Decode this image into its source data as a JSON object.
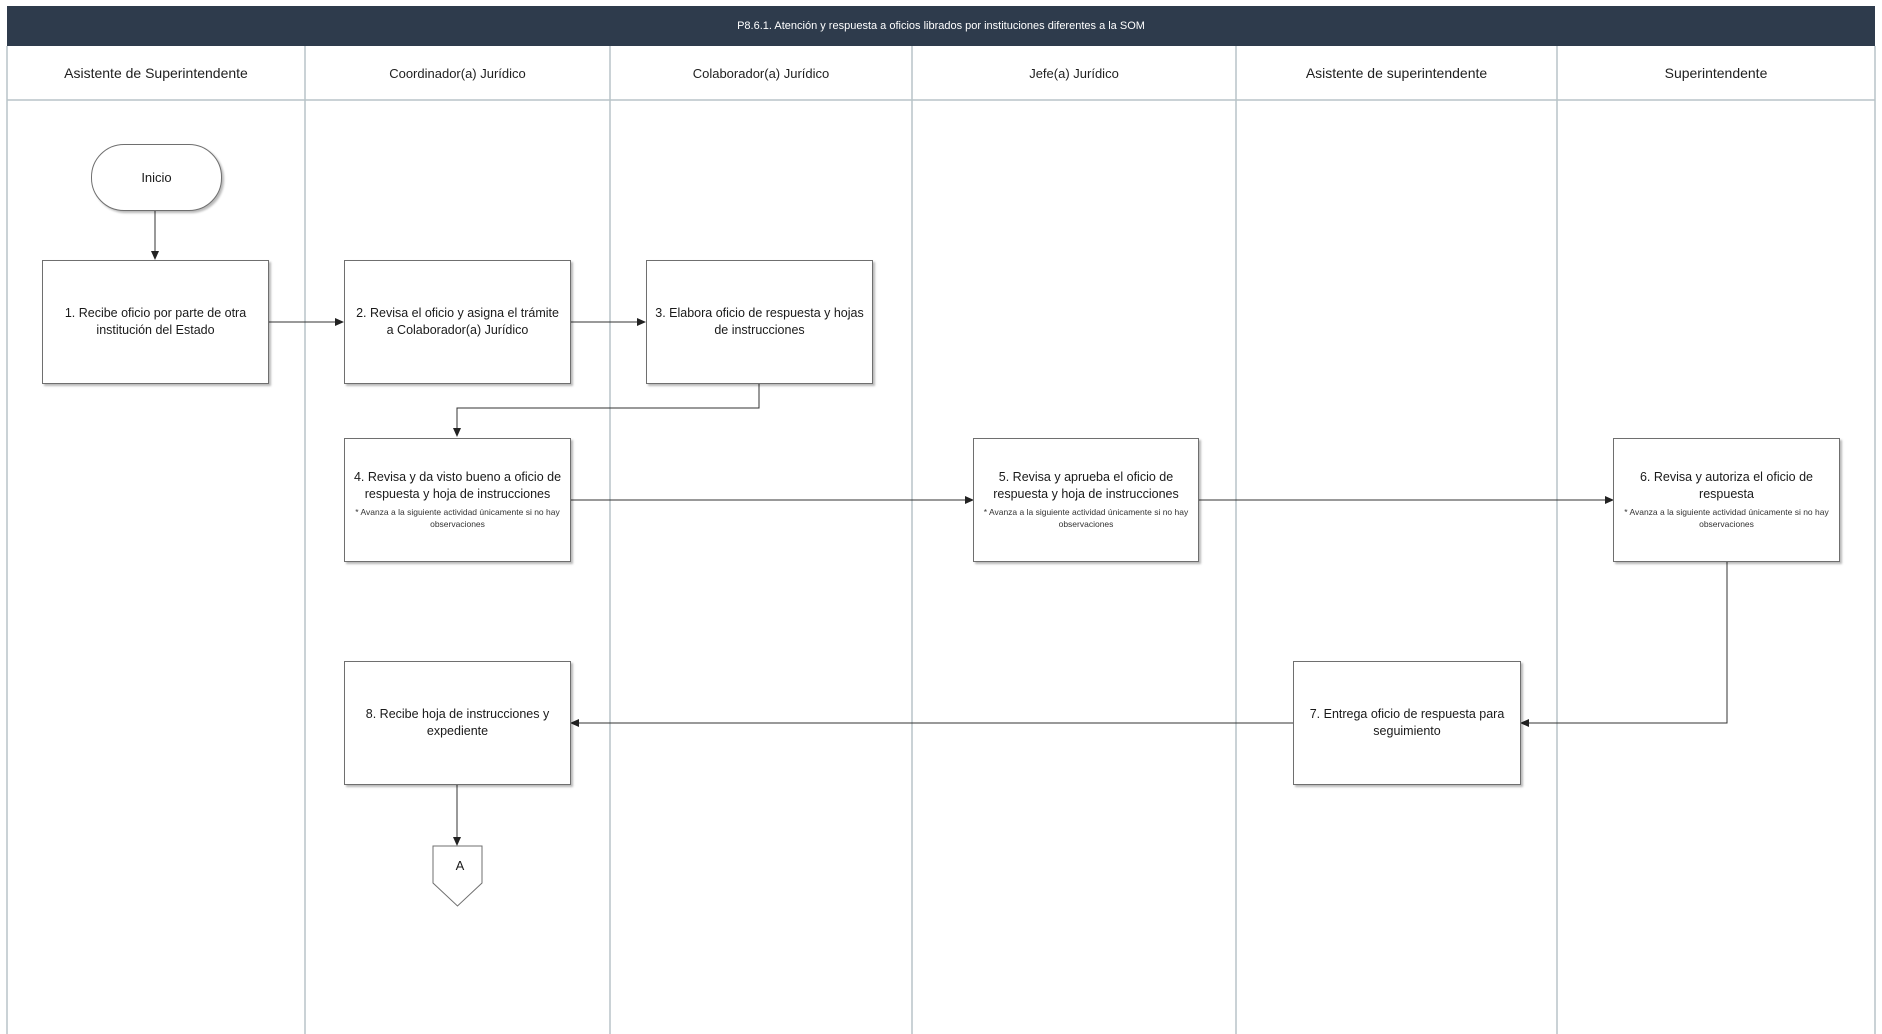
{
  "title": "P8.6.1.  Atención y respuesta a oficios librados por instituciones diferentes a la SOM",
  "lanes": [
    {
      "label": "Asistente de Superintendente"
    },
    {
      "label": "Coordinador(a) Jurídico"
    },
    {
      "label": "Colaborador(a) Jurídico"
    },
    {
      "label": "Jefe(a) Jurídico"
    },
    {
      "label": "Asistente de superintendente"
    },
    {
      "label": "Superintendente"
    }
  ],
  "start": {
    "label": "Inicio"
  },
  "steps": [
    {
      "id": "1",
      "text": "1. Recibe oficio por parte de otra institución del Estado",
      "note": ""
    },
    {
      "id": "2",
      "text": "2. Revisa el oficio y asigna el trámite a Colaborador(a) Jurídico",
      "note": ""
    },
    {
      "id": "3",
      "text": "3. Elabora oficio de respuesta y hojas de instrucciones",
      "note": ""
    },
    {
      "id": "4",
      "text": "4. Revisa y da visto bueno a oficio de respuesta y hoja de instrucciones",
      "note": "* Avanza a la siguiente actividad únicamente si no hay observaciones"
    },
    {
      "id": "5",
      "text": "5. Revisa y aprueba el oficio de respuesta y hoja de instrucciones",
      "note": "* Avanza a la siguiente actividad únicamente si no hay observaciones"
    },
    {
      "id": "6",
      "text": "6.  Revisa y autoriza el oficio de respuesta",
      "note": "* Avanza a la siguiente actividad únicamente si no hay observaciones"
    },
    {
      "id": "7",
      "text": "7. Entrega oficio de respuesta para seguimiento",
      "note": ""
    },
    {
      "id": "8",
      "text": "8. Recibe hoja de instrucciones y expediente",
      "note": ""
    }
  ],
  "offpage_connector": {
    "label": "A"
  },
  "colors": {
    "header_bg": "#2e3b4c",
    "lane_line": "#b8c4c8",
    "arrow": "#222222"
  }
}
